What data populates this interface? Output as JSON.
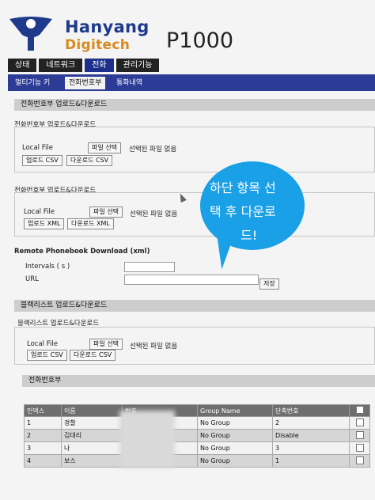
{
  "header": {
    "brand_line1": "Hanyang",
    "brand_line2": "Digitech",
    "model": "P1000"
  },
  "tabs": [
    "상태",
    "네트워크",
    "전화",
    "관리기능"
  ],
  "subtabs": [
    "멀티기능 키",
    "전화번호부",
    "통화내역"
  ],
  "section1": {
    "heading": "전화번호부 업로드&다운로드",
    "title": "전화번호부 업로드&다운로드",
    "local_file_label": "Local File",
    "choose_button": "파일 선택",
    "no_file_text": "선택된 파일 없음",
    "upload_button": "업로드 CSV",
    "download_button": "다운로드 CSV"
  },
  "section2": {
    "title": "전화번호부 업로드&다운로드",
    "local_file_label": "Local File",
    "choose_button": "파일 선택",
    "no_file_text": "선택된 파일 없음",
    "upload_button": "업로드 XML",
    "download_button": "다운로드 XML"
  },
  "remote": {
    "title": "Remote Phonebook Download (xml)",
    "intervals_label": "Intervals ( s )",
    "intervals_value": "",
    "url_label": "URL",
    "url_value": "",
    "save_button": "저장"
  },
  "blacklist": {
    "heading": "블랙리스트 업로드&다운로드",
    "title": "블랙리스트 업로드&다운로드",
    "local_file_label": "Local File",
    "choose_button": "파일 선택",
    "no_file_text": "선택된 파일 없음",
    "upload_button": "업로드 CSV",
    "download_button": "다운로드 CSV"
  },
  "phonebook": {
    "heading": "전화번호부",
    "columns": [
      "인덱스",
      "이름",
      "번호",
      "Group Name",
      "단축번호",
      ""
    ],
    "rows": [
      {
        "index": "1",
        "name": "경찰",
        "group": "No Group",
        "speed": "2"
      },
      {
        "index": "2",
        "name": "김대리",
        "group": "No Group",
        "speed": "Disable"
      },
      {
        "index": "3",
        "name": "나",
        "group": "No Group",
        "speed": "3"
      },
      {
        "index": "4",
        "name": "보스",
        "group": "No Group",
        "speed": "1"
      }
    ]
  },
  "annotation": {
    "line1": "하단 항목 선",
    "line2": "택 후 다운로",
    "line3": "드!"
  },
  "colors": {
    "brand_blue": "#1f3a8a",
    "brand_orange": "#d88a1c",
    "nav_blue": "#2b3b96",
    "bubble": "#1aa0e6"
  }
}
